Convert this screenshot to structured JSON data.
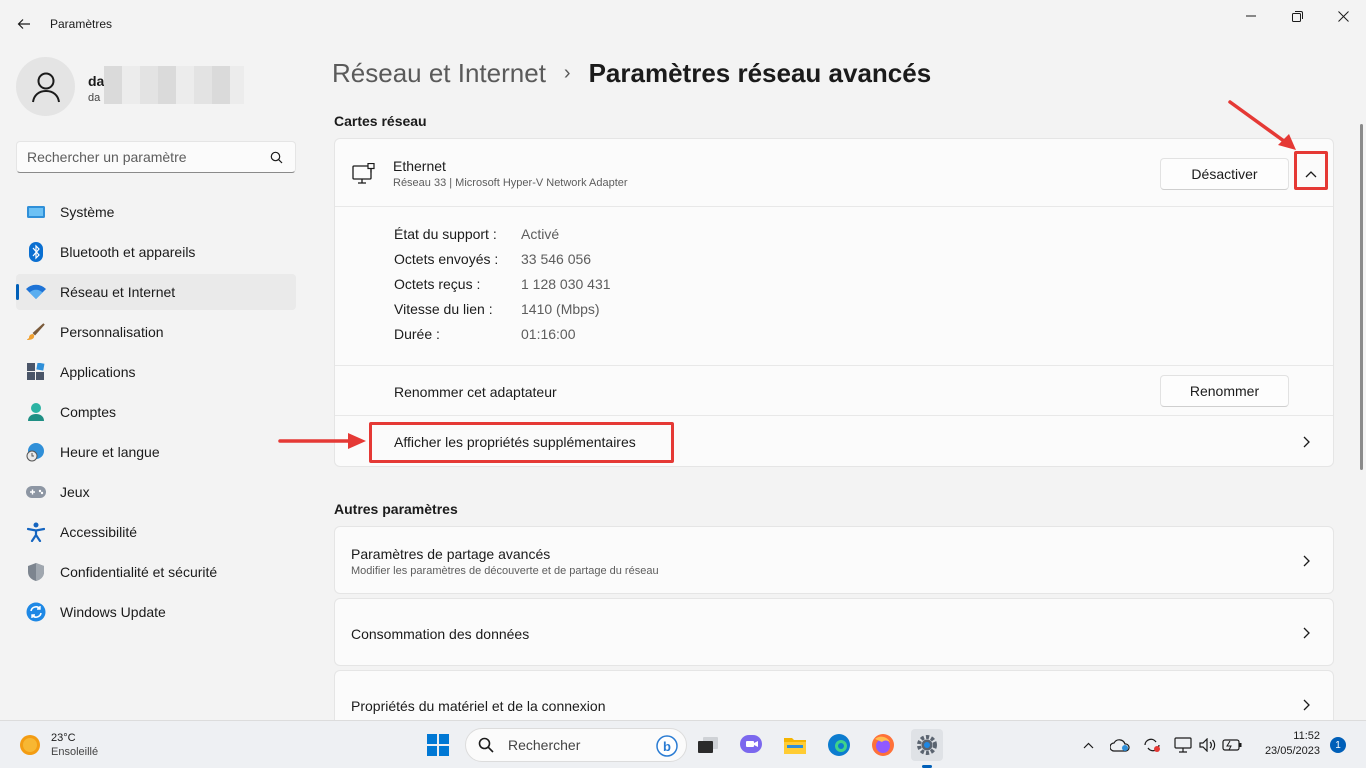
{
  "window": {
    "title": "Paramètres",
    "controls": [
      "minimize",
      "maximize",
      "close"
    ]
  },
  "profile": {
    "name": "da",
    "email": "da"
  },
  "search": {
    "placeholder": "Rechercher un paramètre"
  },
  "sidebar": {
    "items": [
      {
        "label": "Système",
        "icon": "monitor-icon"
      },
      {
        "label": "Bluetooth et appareils",
        "icon": "bluetooth-icon"
      },
      {
        "label": "Réseau et Internet",
        "icon": "wifi-icon",
        "active": true
      },
      {
        "label": "Personnalisation",
        "icon": "brush-icon"
      },
      {
        "label": "Applications",
        "icon": "apps-icon"
      },
      {
        "label": "Comptes",
        "icon": "person-icon"
      },
      {
        "label": "Heure et langue",
        "icon": "globe-clock-icon"
      },
      {
        "label": "Jeux",
        "icon": "gamepad-icon"
      },
      {
        "label": "Accessibilité",
        "icon": "accessibility-icon"
      },
      {
        "label": "Confidentialité et sécurité",
        "icon": "shield-icon"
      },
      {
        "label": "Windows Update",
        "icon": "update-icon"
      }
    ]
  },
  "breadcrumb": {
    "parent": "Réseau et Internet",
    "separator": "›",
    "current": "Paramètres réseau avancés"
  },
  "network_adapters": {
    "section_title": "Cartes réseau",
    "adapter": {
      "name": "Ethernet",
      "description": "Réseau 33 | Microsoft Hyper-V Network Adapter",
      "disable_label": "Désactiver",
      "expanded": true
    },
    "properties": [
      {
        "label": "État du support :",
        "value": "Activé"
      },
      {
        "label": "Octets envoyés :",
        "value": "33 546 056"
      },
      {
        "label": "Octets reçus :",
        "value": "1 128 030 431"
      },
      {
        "label": "Vitesse du lien :",
        "value": "1410 (Mbps)"
      },
      {
        "label": "Durée :",
        "value": "01:16:00"
      }
    ],
    "rename": {
      "label": "Renommer cet adaptateur",
      "button": "Renommer"
    },
    "more_properties_label": "Afficher les propriétés supplémentaires"
  },
  "other_settings": {
    "section_title": "Autres paramètres",
    "items": [
      {
        "title": "Paramètres de partage avancés",
        "subtitle": "Modifier les paramètres de découverte et de partage du réseau"
      },
      {
        "title": "Consommation des données",
        "subtitle": ""
      },
      {
        "title": "Propriétés du matériel et de la connexion",
        "subtitle": ""
      }
    ]
  },
  "taskbar": {
    "weather_temp": "23°C",
    "weather_desc": "Ensoleillé",
    "search_label": "Rechercher",
    "time": "11:52",
    "date": "23/05/2023",
    "notification_count": "1"
  },
  "colors": {
    "accent": "#005fb8",
    "annotation": "#e53935"
  }
}
